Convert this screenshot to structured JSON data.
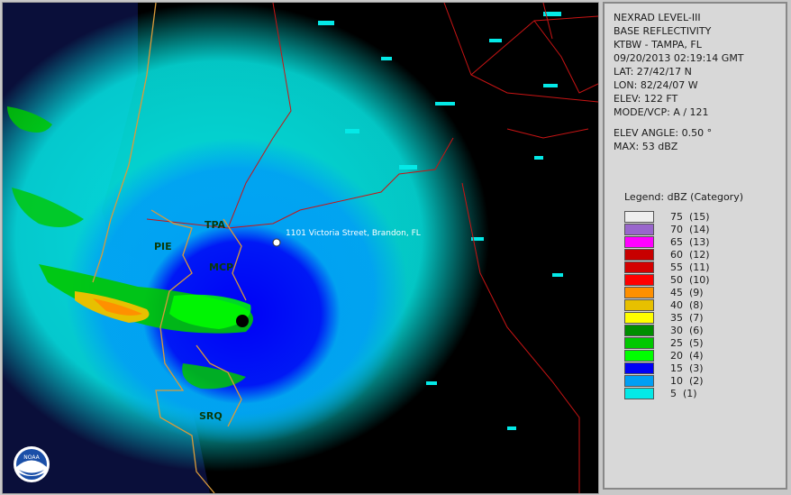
{
  "header": {
    "product": "NEXRAD LEVEL-III",
    "type": "BASE REFLECTIVITY",
    "station": "KTBW - TAMPA, FL",
    "datetime": "09/20/2013 02:19:14 GMT",
    "lat": "LAT: 27/42/17 N",
    "lon": "LON: 82/24/07 W",
    "elev": "ELEV: 122 FT",
    "mode": "MODE/VCP: A / 121",
    "elev_angle": "ELEV ANGLE: 0.50 °",
    "max": "MAX: 53 dBZ"
  },
  "legend": {
    "title": "Legend: dBZ (Category)",
    "items": [
      {
        "label": "75  (15)",
        "color": "#eeeeee"
      },
      {
        "label": "70  (14)",
        "color": "#9966cc"
      },
      {
        "label": "65  (13)",
        "color": "#ff00ff"
      },
      {
        "label": "60  (12)",
        "color": "#c80000"
      },
      {
        "label": "55  (11)",
        "color": "#d40000"
      },
      {
        "label": "50  (10)",
        "color": "#ff0000"
      },
      {
        "label": "45  (9)",
        "color": "#ff9000"
      },
      {
        "label": "40  (8)",
        "color": "#e7c000"
      },
      {
        "label": "35  (7)",
        "color": "#ffff00"
      },
      {
        "label": "30  (6)",
        "color": "#008e00"
      },
      {
        "label": "25  (5)",
        "color": "#00c800"
      },
      {
        "label": "20  (4)",
        "color": "#00ff00"
      },
      {
        "label": "15  (3)",
        "color": "#0000f6"
      },
      {
        "label": "10  (2)",
        "color": "#019ff4"
      },
      {
        "label": "5  (1)",
        "color": "#04e9e7"
      }
    ]
  },
  "map": {
    "cities": [
      "TPA",
      "PIE",
      "MCP",
      "SRQ"
    ],
    "location_label": "1101 Victoria Street, Brandon, FL",
    "logo_text": "NOAA"
  }
}
